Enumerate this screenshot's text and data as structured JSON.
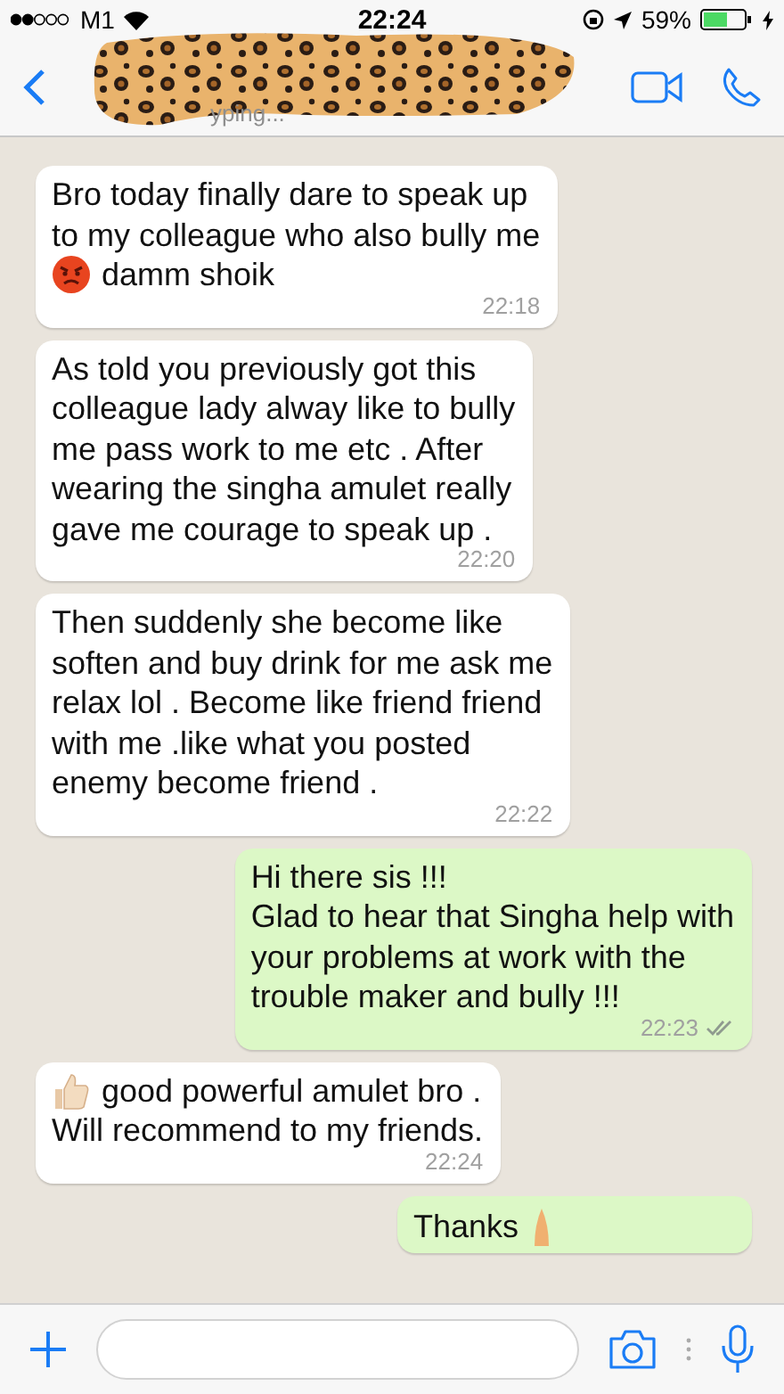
{
  "status_bar": {
    "carrier": "M1",
    "time": "22:24",
    "battery_text": "59%"
  },
  "header": {
    "subtitle": "yping..."
  },
  "messages": [
    {
      "kind": "incoming",
      "lines": [
        {
          "text": "Bro today finally dare to speak up"
        },
        {
          "text": "to my colleague who also bully me"
        },
        {
          "kind": "angry",
          "text": "damm shoik"
        }
      ],
      "time": "22:18"
    },
    {
      "kind": "incoming",
      "lines": [
        {
          "text": "As told you previously got this"
        },
        {
          "text": "colleague lady alway like to bully"
        },
        {
          "text": "me pass work to me etc . After"
        },
        {
          "text": "wearing the singha amulet really"
        },
        {
          "text": "gave me courage to speak up ."
        }
      ],
      "time": "22:20"
    },
    {
      "kind": "incoming",
      "lines": [
        {
          "text": "Then suddenly she become like"
        },
        {
          "text": "soften and buy drink for me ask me"
        },
        {
          "text": "relax lol . Become like friend friend"
        },
        {
          "text": "with me .like what you posted"
        },
        {
          "text": "enemy become friend ."
        }
      ],
      "time": "22:22"
    },
    {
      "kind": "outgoing",
      "lines": [
        {
          "text": "Hi there sis !!!"
        },
        {
          "text": "Glad to hear that Singha help with"
        },
        {
          "text": "your problems at work with the"
        },
        {
          "text": "trouble maker and bully !!!"
        }
      ],
      "time": "22:23",
      "read": false
    },
    {
      "kind": "incoming",
      "lines": [
        {
          "kind": "thumbs",
          "text": "good powerful amulet bro ."
        },
        {
          "text": "Will recommend to my friends."
        }
      ],
      "time": "22:24"
    },
    {
      "kind": "outgoing",
      "lines": [
        {
          "kind": "hands",
          "text": "Thanks"
        }
      ]
    }
  ]
}
